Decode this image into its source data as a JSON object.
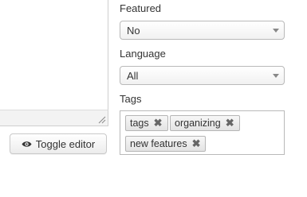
{
  "editor": {
    "toggle_label": "Toggle editor",
    "toggle_icon": "eye-icon"
  },
  "featured": {
    "label": "Featured",
    "selected": "No"
  },
  "language": {
    "label": "Language",
    "selected": "All"
  },
  "tags": {
    "label": "Tags",
    "items": [
      "tags",
      "organizing",
      "new features"
    ],
    "remove_glyph": "✖"
  },
  "colors": {
    "border": "#b9b9b9",
    "text": "#333333",
    "tag_bg": "#e8e8e8"
  }
}
